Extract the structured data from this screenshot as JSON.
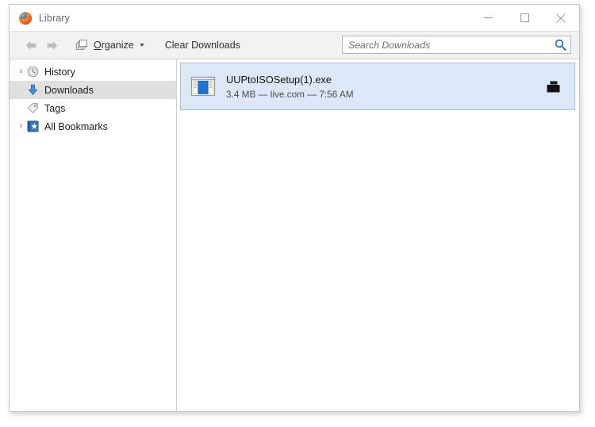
{
  "window": {
    "title": "Library",
    "app_icon": "firefox-logo-icon",
    "controls": {
      "minimize": "minimize-icon",
      "maximize": "maximize-icon",
      "close": "close-icon"
    }
  },
  "toolbar": {
    "back": "back-arrow-icon",
    "forward": "forward-arrow-icon",
    "organize_label_prefix": "O",
    "organize_label_rest": "rganize",
    "organize_icon": "organize-windows-icon",
    "clear_downloads_label": "Clear Downloads"
  },
  "search": {
    "placeholder": "Search Downloads",
    "value": "",
    "icon": "search-magnifier-icon",
    "icon_color": "#2c6fb5"
  },
  "sidebar": {
    "items": [
      {
        "label": "History",
        "icon": "history-clock-icon",
        "twisty": "›",
        "selected": false
      },
      {
        "label": "Downloads",
        "icon": "downloads-arrow-icon",
        "twisty": "",
        "selected": true
      },
      {
        "label": "Tags",
        "icon": "tag-icon",
        "twisty": "",
        "selected": false
      },
      {
        "label": "All Bookmarks",
        "icon": "bookmarks-star-icon",
        "twisty": "›",
        "selected": false
      }
    ]
  },
  "downloads": {
    "items": [
      {
        "name": "UUPtoISOSetup(1).exe",
        "details": "3.4 MB — live.com — 7:56 AM",
        "file_icon": "executable-window-icon",
        "action_icon": "open-folder-icon",
        "selected": true
      }
    ]
  },
  "colors": {
    "selection_bg": "#dce8f7",
    "selection_border": "#a8c2e2",
    "sidebar_selected_bg": "#e0e0e0",
    "toolbar_bg": "#f2f2f2",
    "accent_blue": "#2c6fb5"
  }
}
